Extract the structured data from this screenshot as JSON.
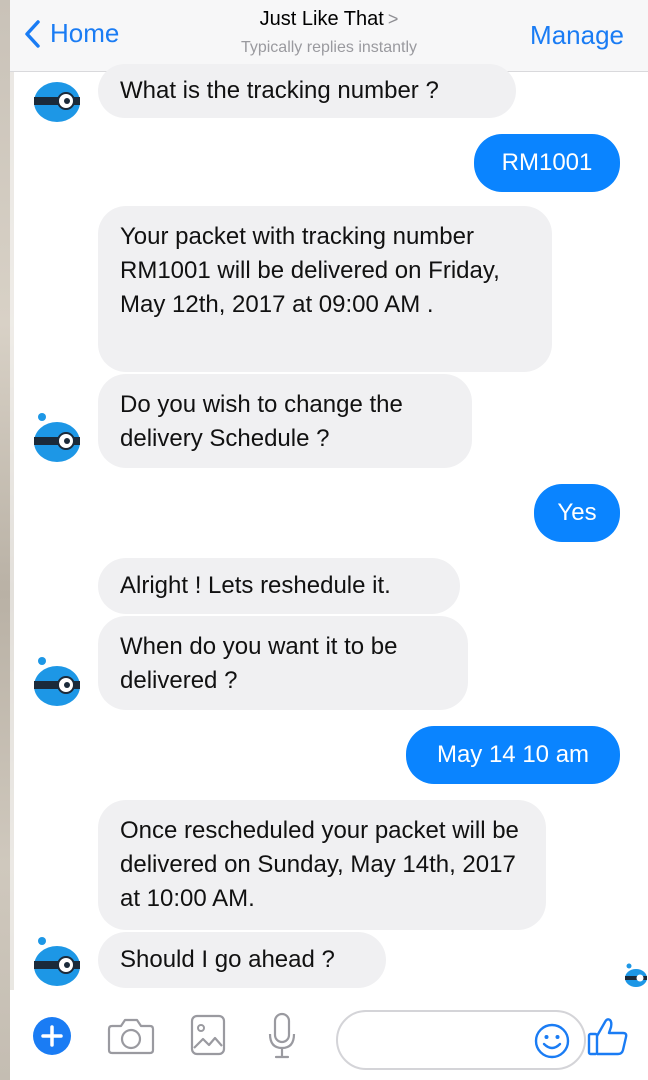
{
  "header": {
    "back_label": "Home",
    "title": "Just Like That",
    "title_chevron": ">",
    "subtitle": "Typically replies instantly",
    "manage_label": "Manage"
  },
  "messages": [
    {
      "from": "bot",
      "text": "What is the tracking number ?"
    },
    {
      "from": "user",
      "text": "RM1001"
    },
    {
      "from": "bot",
      "text": "Your packet with tracking number RM1001 will be delivered on Friday, May 12th, 2017 at 09:00 AM ."
    },
    {
      "from": "bot",
      "text": "Do you wish to change the delivery Schedule ?"
    },
    {
      "from": "user",
      "text": "Yes"
    },
    {
      "from": "bot",
      "text": "Alright ! Lets reshedule it."
    },
    {
      "from": "bot",
      "text": "When do you want it to be delivered ?"
    },
    {
      "from": "user",
      "text": "May 14 10 am"
    },
    {
      "from": "bot",
      "text": "Once rescheduled your packet will be delivered on Sunday, May 14th, 2017 at 10:00 AM."
    },
    {
      "from": "bot",
      "text": "Should I go ahead ?"
    }
  ],
  "composer": {
    "input_value": "",
    "icons": [
      "plus-icon",
      "camera-icon",
      "image-icon",
      "microphone-icon",
      "emoji-icon",
      "thumbs-up-icon"
    ]
  },
  "colors": {
    "accent": "#0a84ff",
    "incoming_bubble": "#f0f0f2",
    "header_bg": "#f7f7f8"
  }
}
